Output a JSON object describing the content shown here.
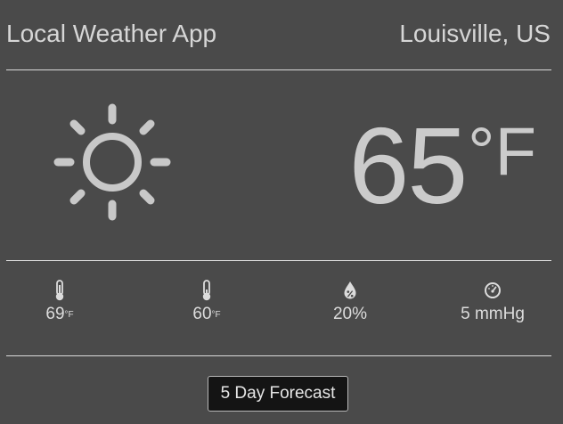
{
  "header": {
    "app_title": "Local Weather App",
    "location": "Louisville, US"
  },
  "current": {
    "condition_icon": "sun-icon",
    "temperature": "65",
    "unit": "°F"
  },
  "stats": [
    {
      "icon": "thermometer-icon",
      "value": "69",
      "unit": "°F"
    },
    {
      "icon": "thermometer-icon",
      "value": "60",
      "unit": "°F"
    },
    {
      "icon": "humidity-drop-icon",
      "value": "20%",
      "unit": ""
    },
    {
      "icon": "pressure-gauge-icon",
      "value": "5 mmHg",
      "unit": ""
    }
  ],
  "forecast_button_label": "5 Day Forecast",
  "colors": {
    "background": "#4a4a4a",
    "text": "#d6d6d6",
    "icon": "#c8c8c8",
    "button_background": "#141414"
  }
}
